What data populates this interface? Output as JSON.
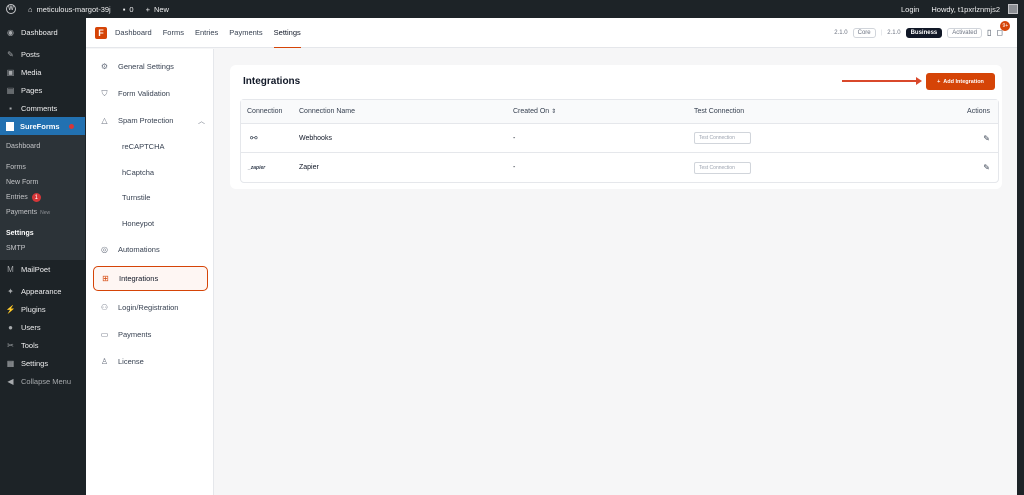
{
  "adminbar": {
    "site_name": "meticulous-margot-39j",
    "comments_count": "0",
    "new_label": "New",
    "login_label": "Login",
    "howdy_label": "Howdy, t1pxrlznmjs2"
  },
  "wpmenu": {
    "items_top": [
      "Dashboard"
    ],
    "items_main": [
      "Posts",
      "Media",
      "Pages",
      "Comments"
    ],
    "sureforms_label": "SureForms",
    "sureforms_sub": {
      "dashboard": "Dashboard",
      "forms": "Forms",
      "new_form": "New Form",
      "entries": "Entries",
      "entries_count": "1",
      "payments": "Payments",
      "payments_new": "New",
      "settings": "Settings",
      "smtp": "SMTP"
    },
    "mailpoet": "MailPoet",
    "items_bottom": [
      "Appearance",
      "Plugins",
      "Users",
      "Tools",
      "Settings"
    ],
    "collapse": "Collapse Menu"
  },
  "topnav": {
    "links": [
      "Dashboard",
      "Forms",
      "Entries",
      "Payments",
      "Settings"
    ],
    "active": "Settings",
    "version_core": "2.1.0",
    "core_label": "Core",
    "version_business": "2.1.0",
    "business_label": "Business",
    "activated_label": "Activated",
    "notif_count": "9+"
  },
  "settings_sidebar": {
    "general": "General Settings",
    "form_validation": "Form Validation",
    "spam_protection": "Spam Protection",
    "spam_items": [
      "reCAPTCHA",
      "hCaptcha",
      "Turnstile",
      "Honeypot"
    ],
    "automations": "Automations",
    "integrations": "Integrations",
    "login_registration": "Login/Registration",
    "payments": "Payments",
    "license": "License"
  },
  "integrations": {
    "title": "Integrations",
    "add_button": "Add Integration",
    "columns": [
      "Connection",
      "Connection Name",
      "Created On",
      "Test Connection",
      "Actions"
    ],
    "rows": [
      {
        "icon": "webhook-icon",
        "name": "Webhooks",
        "created_on": "-",
        "test_label": "Test Connection"
      },
      {
        "icon": "zapier-icon",
        "icon_text": "_zapier",
        "name": "Zapier",
        "created_on": "-",
        "test_label": "Test Connection"
      }
    ]
  },
  "colors": {
    "accent": "#d54407",
    "wp_dark": "#1d2327",
    "wp_blue": "#2271b1"
  }
}
